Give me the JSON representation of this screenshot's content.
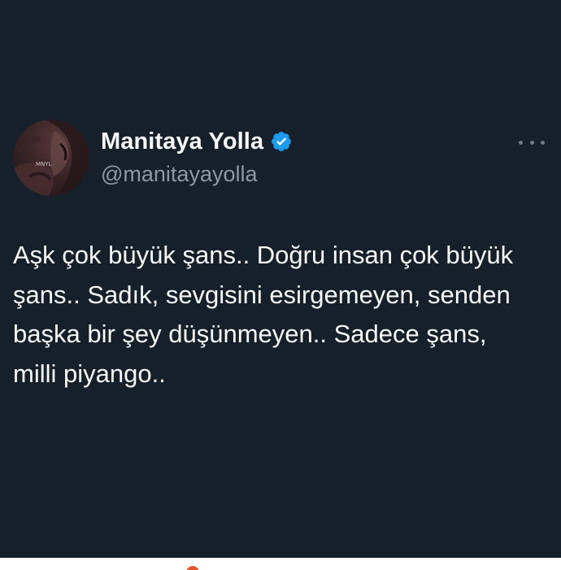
{
  "tweet": {
    "author": {
      "display_name": "Manitaya Yolla",
      "handle": "@manitayayolla",
      "verified": true,
      "avatar_watermark": "MNYL"
    },
    "text": "Aşk çok büyük şans.. Doğru insan çok büyük şans.. Sadık, sevgisini esirgemeyen, senden başka bir şey düşünmeyen.. Sadece şans, milli piyango..",
    "more_icon": "more-horizontal-icon"
  },
  "colors": {
    "background": "#15202b",
    "text_primary": "#f7f9f9",
    "text_secondary": "#8b98a5",
    "verified_blue": "#1d9bf0"
  }
}
